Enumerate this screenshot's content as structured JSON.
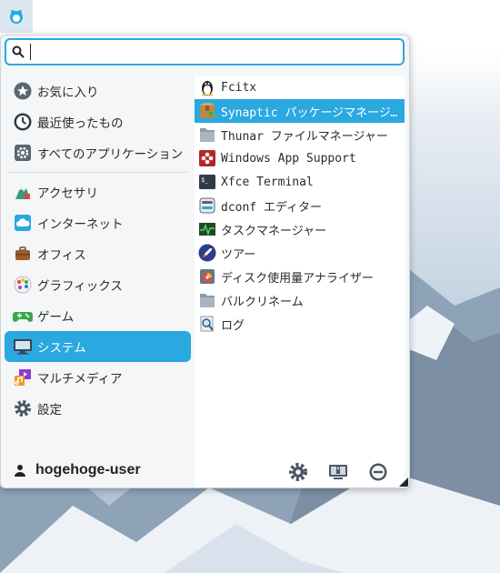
{
  "search": {
    "value": "",
    "placeholder": ""
  },
  "categories": [
    {
      "label": "お気に入り",
      "icon": "star-icon"
    },
    {
      "label": "最近使ったもの",
      "icon": "clock-icon"
    },
    {
      "label": "すべてのアプリケーション",
      "icon": "gear-icon"
    },
    {
      "label": "アクセサリ",
      "icon": "accessories-icon"
    },
    {
      "label": "インターネット",
      "icon": "cloud-icon"
    },
    {
      "label": "オフィス",
      "icon": "briefcase-icon"
    },
    {
      "label": "グラフィックス",
      "icon": "palette-icon"
    },
    {
      "label": "ゲーム",
      "icon": "gamepad-icon"
    },
    {
      "label": "システム",
      "icon": "monitor-icon",
      "selected": true
    },
    {
      "label": "マルチメディア",
      "icon": "multimedia-icon"
    },
    {
      "label": "設定",
      "icon": "settings-icon"
    }
  ],
  "apps": [
    {
      "label": "Fcitx",
      "icon": "penguin-icon"
    },
    {
      "label": "Synaptic パッケージマネージャー",
      "icon": "package-icon",
      "selected": true
    },
    {
      "label": "Thunar ファイルマネージャー",
      "icon": "folder-icon"
    },
    {
      "label": "Windows App Support",
      "icon": "wine-icon"
    },
    {
      "label": "Xfce Terminal",
      "icon": "terminal-icon"
    },
    {
      "label": "dconf エディター",
      "icon": "dconf-icon"
    },
    {
      "label": "タスクマネージャー",
      "icon": "task-manager-icon"
    },
    {
      "label": "ツアー",
      "icon": "rocket-icon"
    },
    {
      "label": "ディスク使用量アナライザー",
      "icon": "disk-analyzer-icon"
    },
    {
      "label": "バルクリネーム",
      "icon": "folder-icon"
    },
    {
      "label": "ログ",
      "icon": "log-icon"
    }
  ],
  "user": {
    "name": "hogehoge-user"
  },
  "colors": {
    "accent": "#2aa8e0"
  }
}
